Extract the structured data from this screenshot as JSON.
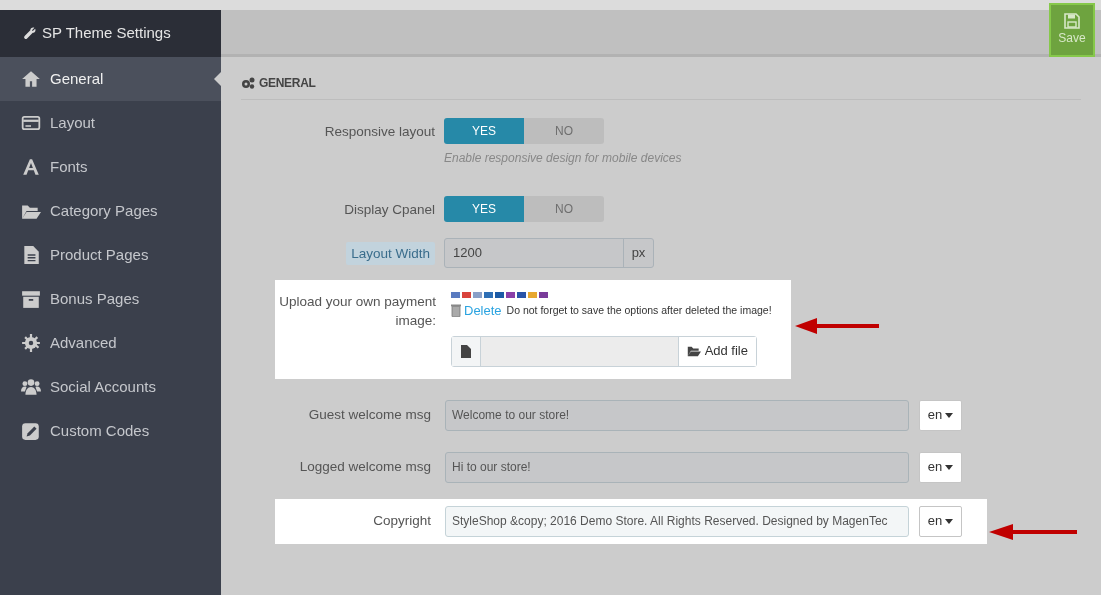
{
  "sidebar": {
    "title": "SP Theme Settings",
    "items": [
      {
        "label": "General",
        "selected": true
      },
      {
        "label": "Layout",
        "selected": false
      },
      {
        "label": "Fonts",
        "selected": false
      },
      {
        "label": "Category Pages",
        "selected": false
      },
      {
        "label": "Product Pages",
        "selected": false
      },
      {
        "label": "Bonus Pages",
        "selected": false
      },
      {
        "label": "Advanced",
        "selected": false
      },
      {
        "label": "Social Accounts",
        "selected": false
      },
      {
        "label": "Custom Codes",
        "selected": false
      }
    ]
  },
  "toolbar": {
    "save": "Save"
  },
  "section": {
    "title": "GENERAL"
  },
  "fields": [
    {
      "kind": "toggle",
      "label": "Responsive layout",
      "options": [
        {
          "label": "YES",
          "selected": true
        },
        {
          "label": "NO",
          "selected": false
        }
      ],
      "hint": "Enable responsive design for mobile devices"
    },
    {
      "kind": "toggle",
      "label": "Display Cpanel",
      "options": [
        {
          "label": "YES",
          "selected": true
        },
        {
          "label": "NO",
          "selected": false
        }
      ]
    },
    {
      "kind": "addon",
      "label": "Layout Width",
      "label_highlighted": true,
      "value": "1200",
      "addon": "px"
    },
    {
      "kind": "upload",
      "label": "Upload your own payment image:",
      "highlighted": true,
      "delete": "Delete",
      "note": "Do not forget to save the options after deleted the image!",
      "button": "Add file"
    },
    {
      "kind": "lang",
      "label": "Guest welcome msg",
      "value": "Welcome to our store!",
      "lang": "en",
      "highlighted": false
    },
    {
      "kind": "lang",
      "label": "Logged welcome msg",
      "value": "Hi to our store!",
      "lang": "en",
      "highlighted": false
    },
    {
      "kind": "lang",
      "label": "Copyright",
      "value": "StyleShop &copy; 2016 Demo Store. All Rights Reserved. Designed by MagenTec",
      "lang": "en",
      "highlighted": true
    }
  ]
}
